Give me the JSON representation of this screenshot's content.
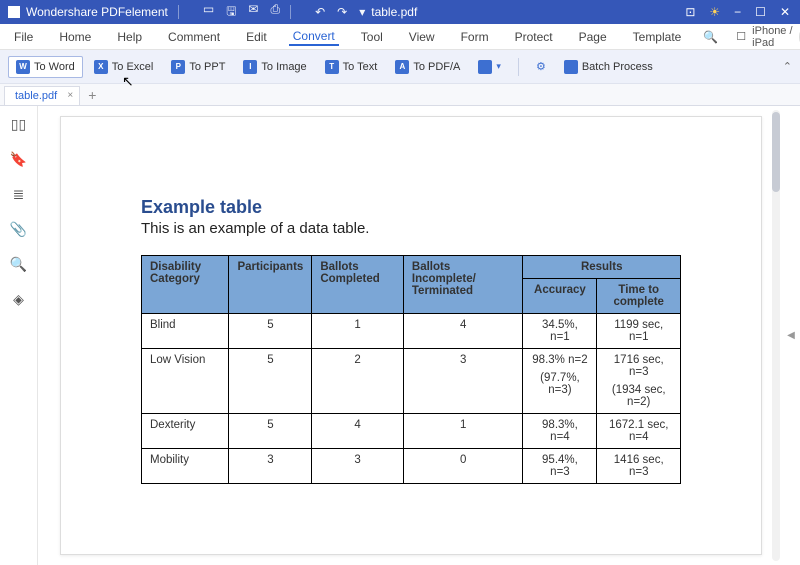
{
  "titlebar": {
    "appname": "Wondershare PDFelement",
    "filename": "table.pdf"
  },
  "menu": {
    "items": [
      "File",
      "Home",
      "Help",
      "Comment",
      "Edit",
      "Convert",
      "Tool",
      "View",
      "Form",
      "Protect",
      "Page",
      "Template"
    ],
    "active": "Convert",
    "device": "iPhone / iPad"
  },
  "ribbon": {
    "to_word": "To Word",
    "to_excel": "To Excel",
    "to_ppt": "To PPT",
    "to_image": "To Image",
    "to_text": "To Text",
    "to_pdfa": "To PDF/A",
    "batch": "Batch Process"
  },
  "dtab": {
    "name": "table.pdf"
  },
  "doc": {
    "title": "Example table",
    "subtitle": "This is an example of a data table.",
    "headers": {
      "cat": "Disability Category",
      "part": "Participants",
      "bc": "Ballots Completed",
      "bit": "Ballots Incomplete/ Terminated",
      "res": "Results",
      "acc": "Accuracy",
      "ttc": "Time to complete"
    },
    "rows": [
      {
        "cat": "Blind",
        "part": "5",
        "bc": "1",
        "bit": "4",
        "acc": "34.5%, n=1",
        "ttc": "1199 sec, n=1",
        "acc2": "",
        "ttc2": ""
      },
      {
        "cat": "Low Vision",
        "part": "5",
        "bc": "2",
        "bit": "3",
        "acc": "98.3% n=2",
        "ttc": "1716 sec, n=3",
        "acc2": "(97.7%, n=3)",
        "ttc2": "(1934 sec, n=2)"
      },
      {
        "cat": "Dexterity",
        "part": "5",
        "bc": "4",
        "bit": "1",
        "acc": "98.3%, n=4",
        "ttc": "1672.1 sec, n=4",
        "acc2": "",
        "ttc2": ""
      },
      {
        "cat": "Mobility",
        "part": "3",
        "bc": "3",
        "bit": "0",
        "acc": "95.4%, n=3",
        "ttc": "1416 sec, n=3",
        "acc2": "",
        "ttc2": ""
      }
    ]
  },
  "chart_data": {
    "type": "table",
    "title": "Example table",
    "columns": [
      "Disability Category",
      "Participants",
      "Ballots Completed",
      "Ballots Incomplete/Terminated",
      "Accuracy",
      "Time to complete"
    ],
    "rows": [
      [
        "Blind",
        5,
        1,
        4,
        "34.5%, n=1",
        "1199 sec, n=1"
      ],
      [
        "Low Vision",
        5,
        2,
        3,
        "98.3% n=2 (97.7%, n=3)",
        "1716 sec, n=3 (1934 sec, n=2)"
      ],
      [
        "Dexterity",
        5,
        4,
        1,
        "98.3%, n=4",
        "1672.1 sec, n=4"
      ],
      [
        "Mobility",
        3,
        3,
        0,
        "95.4%, n=3",
        "1416 sec, n=3"
      ]
    ]
  }
}
